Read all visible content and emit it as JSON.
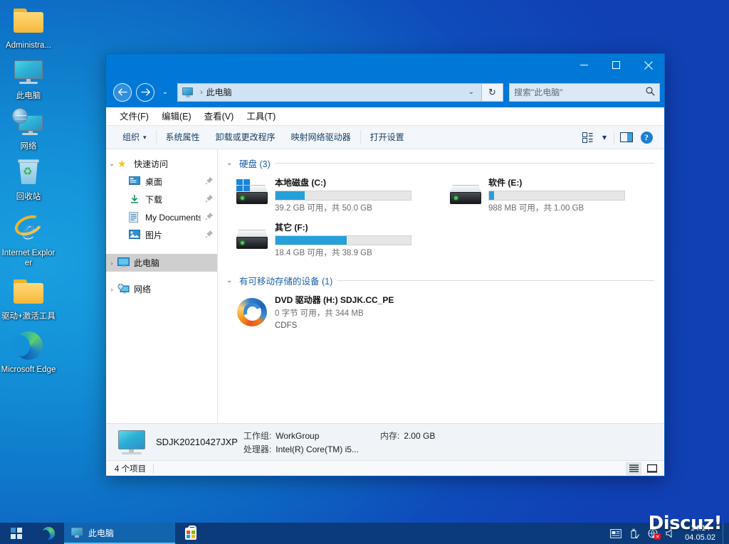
{
  "desktop": {
    "icons": [
      {
        "label": "Administra...",
        "icon": "folder-icon"
      },
      {
        "label": "此电脑",
        "icon": "computer-icon"
      },
      {
        "label": "网络",
        "icon": "network-icon"
      },
      {
        "label": "回收站",
        "icon": "recycle-bin-icon"
      },
      {
        "label": "Internet Explorer",
        "icon": "internet-explorer-icon"
      },
      {
        "label": "驱动+激活工具",
        "icon": "folder-icon"
      },
      {
        "label": "Microsoft Edge",
        "icon": "microsoft-edge-icon"
      }
    ],
    "watermark": "Discuz!"
  },
  "window": {
    "title": "此电脑",
    "controls": {
      "minimize": "—",
      "maximize": "▢",
      "close": "✕"
    },
    "nav": {
      "back": "←",
      "forward": "→",
      "recent_caret": "⌄",
      "address_icon": "computer-icon",
      "breadcrumb_sep": "›",
      "breadcrumb": "此电脑",
      "address_caret": "⌄",
      "refresh": "↻"
    },
    "search": {
      "placeholder": "搜索\"此电脑\"",
      "icon": "search-icon"
    },
    "menubar": [
      {
        "label": "文件(F)"
      },
      {
        "label": "编辑(E)"
      },
      {
        "label": "查看(V)"
      },
      {
        "label": "工具(T)"
      }
    ],
    "toolbar": {
      "items": [
        {
          "label": "组织",
          "caret": "▾"
        },
        {
          "label": "系统属性"
        },
        {
          "label": "卸载或更改程序"
        },
        {
          "label": "映射网络驱动器"
        },
        {
          "label": "打开设置"
        }
      ],
      "view_caret": "▾",
      "help_label": "?"
    },
    "navpane": {
      "groups": [
        {
          "twisty": "⌄",
          "icon": "star-icon",
          "label": "快速访问",
          "children": [
            {
              "icon": "desktop-icon",
              "label": "桌面",
              "pin": "📌"
            },
            {
              "icon": "downloads-icon",
              "label": "下载",
              "pin": "📌"
            },
            {
              "icon": "documents-icon",
              "label": "My Documents",
              "pin": "📌"
            },
            {
              "icon": "pictures-icon",
              "label": "图片",
              "pin": "📌"
            }
          ]
        },
        {
          "twisty": "›",
          "icon": "computer-icon",
          "label": "此电脑",
          "selected": true,
          "children": []
        },
        {
          "twisty": "›",
          "icon": "network-icon",
          "label": "网络",
          "children": []
        }
      ]
    },
    "content": {
      "groups": [
        {
          "chevron": "⌄",
          "title": "硬盘 (3)",
          "items": [
            {
              "icon": "hard-drive-windows-icon",
              "name": "本地磁盘 (C:)",
              "capacity_text": "39.2 GB 可用，共 50.0 GB",
              "used_percent": 21.6
            },
            {
              "icon": "hard-drive-icon",
              "name": "软件 (E:)",
              "capacity_text": "988 MB 可用，共 1.00 GB",
              "used_percent": 3.5
            },
            {
              "icon": "hard-drive-icon",
              "name": "其它 (F:)",
              "capacity_text": "18.4 GB 可用，共 38.9 GB",
              "used_percent": 52.7
            }
          ]
        },
        {
          "chevron": "⌄",
          "title": "有可移动存储的设备 (1)",
          "items": [
            {
              "icon": "dvd-drive-icon",
              "name": "DVD 驱动器 (H:) SDJK.CC_PE",
              "capacity_text": "0 字节 可用，共 344 MB",
              "filesystem": "CDFS"
            }
          ]
        }
      ]
    },
    "details": {
      "hostname": "SDJK20210427JXP",
      "rows": [
        {
          "key": "工作组:",
          "value": "WorkGroup"
        },
        {
          "key": "处理器:",
          "value": "Intel(R) Core(TM) i5..."
        }
      ],
      "memory_key": "内存:",
      "memory_value": "2.00 GB"
    },
    "statusbar": {
      "count": "4 个项目",
      "details_view_icon": "details-view-icon",
      "tiles_view_icon": "large-icons-view-icon"
    }
  },
  "taskbar": {
    "start_label": "start-button",
    "edge_label": "microsoft-edge-icon",
    "task": {
      "icon": "computer-icon",
      "label": "此电脑"
    },
    "store_label": "microsoft-store-icon",
    "tray": [
      {
        "icon": "news-and-interests-icon"
      },
      {
        "icon": "usb-eject-icon"
      },
      {
        "icon": "network-disconnected-icon"
      },
      {
        "icon": "volume-muted-icon"
      }
    ],
    "clock": {
      "time": "14:14",
      "date": "04.05.02"
    }
  }
}
